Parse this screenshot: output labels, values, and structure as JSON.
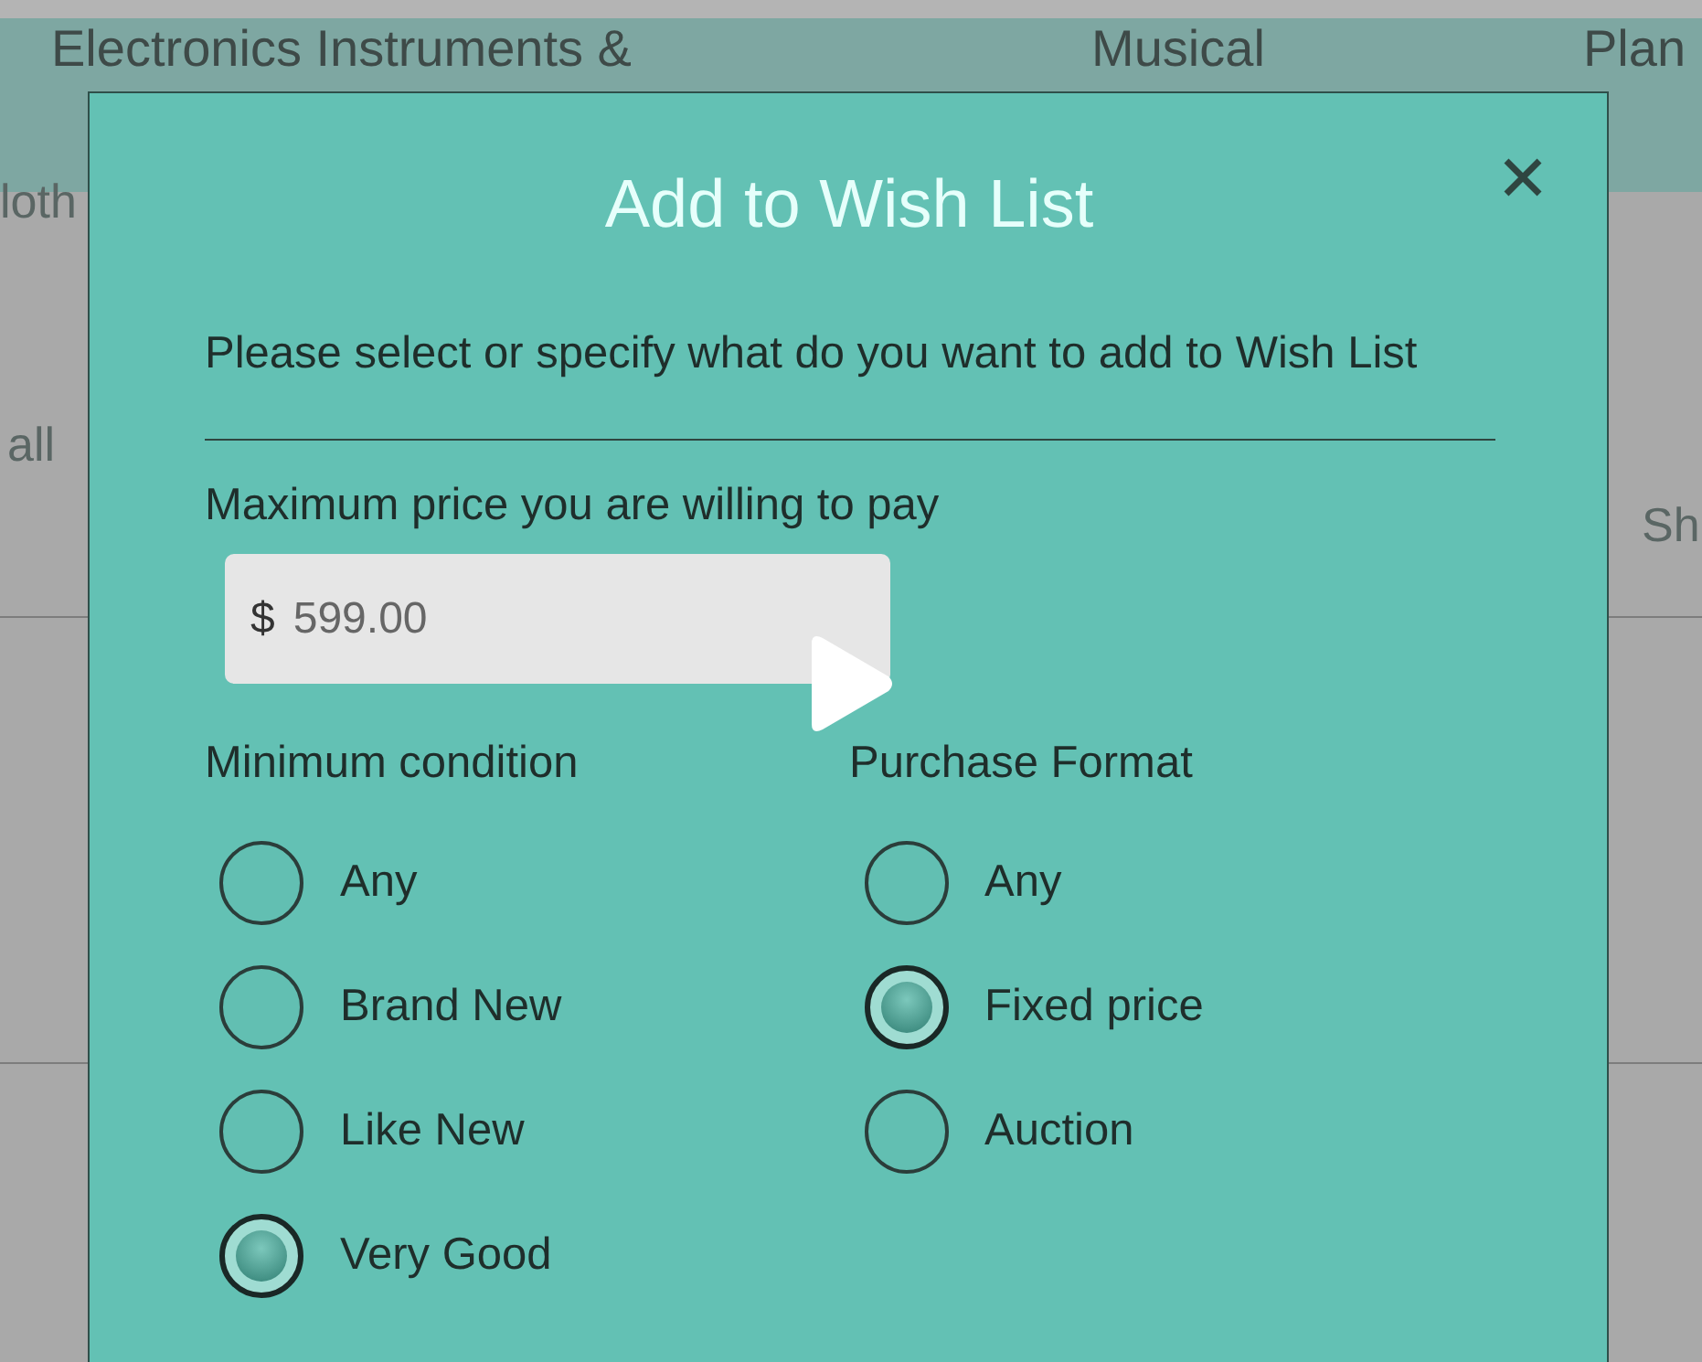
{
  "background_page": {
    "nav_items": [
      "Electronics Instruments &",
      "Musical",
      "Plan"
    ],
    "left_fragments": [
      "loth",
      "all"
    ],
    "right_fragments": [
      "Sh"
    ]
  },
  "dialog": {
    "title": "Add to Wish List",
    "description": "Please select or specify what do you want to add to Wish List",
    "price_label": "Maximum price you are willing to pay",
    "price_field": {
      "prefix": "$",
      "value": "599.00"
    },
    "groups": [
      {
        "label": "Minimum condition",
        "options": [
          {
            "label": "Any",
            "selected": false
          },
          {
            "label": "Brand New",
            "selected": false
          },
          {
            "label": "Like New",
            "selected": false
          },
          {
            "label": "Very Good",
            "selected": true
          }
        ]
      },
      {
        "label": "Purchase Format",
        "options": [
          {
            "label": "Any",
            "selected": false
          },
          {
            "label": "Fixed price",
            "selected": true
          },
          {
            "label": "Auction",
            "selected": false
          }
        ]
      }
    ]
  }
}
